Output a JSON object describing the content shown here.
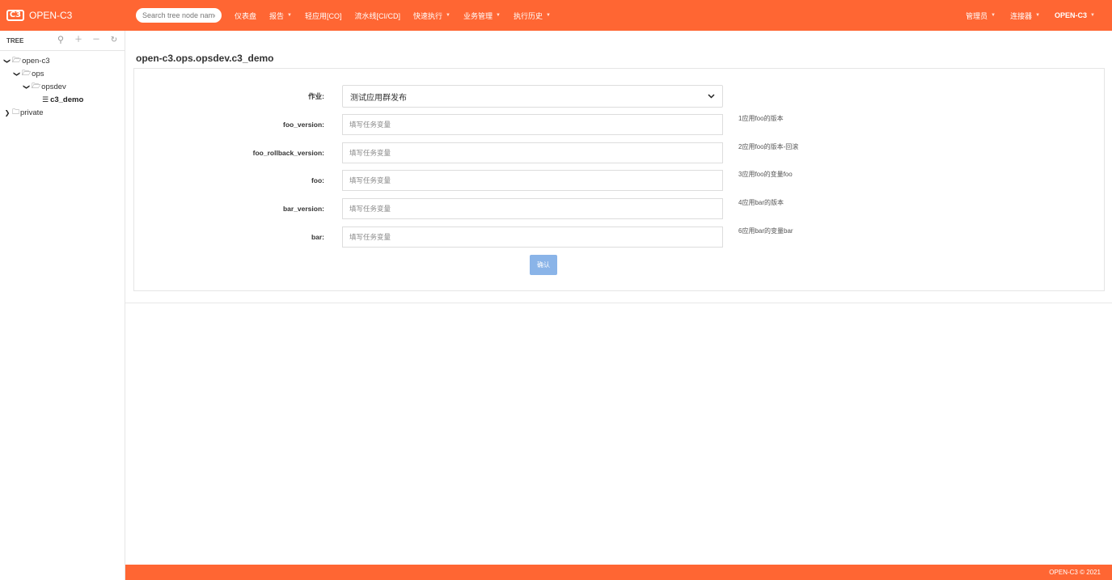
{
  "brand": {
    "logo": "C3",
    "name": "OPEN-C3"
  },
  "search": {
    "placeholder": "Search tree node name"
  },
  "nav": {
    "items": [
      {
        "label": "仪表盘",
        "dropdown": false
      },
      {
        "label": "报告",
        "dropdown": true
      },
      {
        "label": "轻应用[CO]",
        "dropdown": false
      },
      {
        "label": "流水线[CI/CD]",
        "dropdown": false
      },
      {
        "label": "快速执行",
        "dropdown": true
      },
      {
        "label": "业务管理",
        "dropdown": true
      },
      {
        "label": "执行历史",
        "dropdown": true
      }
    ],
    "right": [
      {
        "label": "管理员",
        "dropdown": true
      },
      {
        "label": "连接器",
        "dropdown": true
      },
      {
        "label": "OPEN-C3",
        "dropdown": true
      }
    ]
  },
  "sidebar": {
    "title": "TREE",
    "tools": [
      "location-icon",
      "plus-icon",
      "minus-icon",
      "refresh-icon"
    ],
    "tree": [
      {
        "label": "open-c3",
        "expanded": true
      },
      {
        "label": "ops",
        "expanded": true
      },
      {
        "label": "opsdev",
        "expanded": true
      },
      {
        "label": "c3_demo",
        "selected": true
      },
      {
        "label": "private",
        "expanded": false
      }
    ]
  },
  "main": {
    "title": "open-c3.ops.opsdev.c3_demo",
    "job": {
      "label": "作业:",
      "value": "测试应用群发布"
    },
    "fields": [
      {
        "label": "foo_version:",
        "placeholder": "填写任务变量",
        "hint": "1应用foo的版本"
      },
      {
        "label": "foo_rollback_version:",
        "placeholder": "填写任务变量",
        "hint": "2应用foo的版本-回滚"
      },
      {
        "label": "foo:",
        "placeholder": "填写任务变量",
        "hint": "3应用foo的变量foo"
      },
      {
        "label": "bar_version:",
        "placeholder": "填写任务变量",
        "hint": "4应用bar的版本"
      },
      {
        "label": "bar:",
        "placeholder": "填写任务变量",
        "hint": "6应用bar的变量bar"
      }
    ],
    "confirm_label": "确认"
  },
  "footer": {
    "copyright": "OPEN-C3 © 2021"
  },
  "colors": {
    "accent": "#ff6633",
    "button": "#8ab4e8"
  }
}
